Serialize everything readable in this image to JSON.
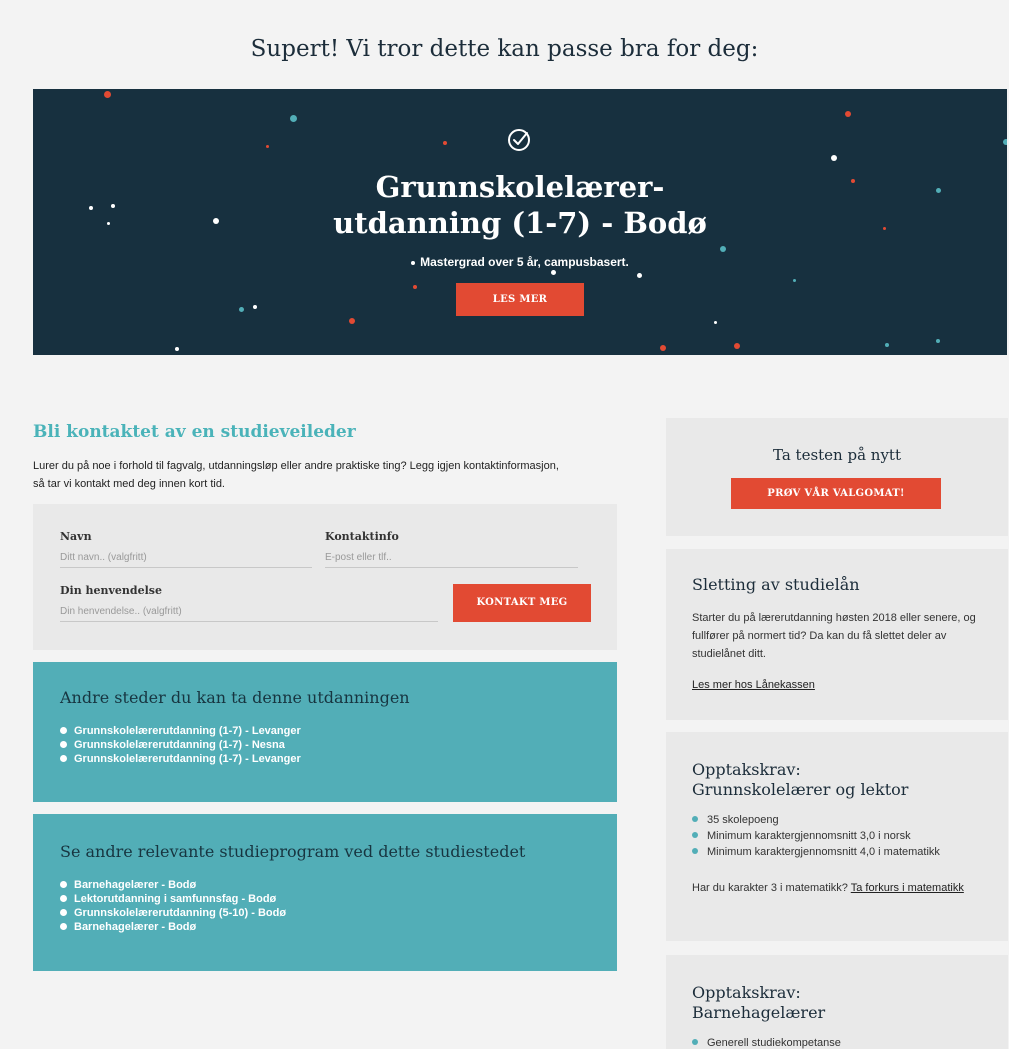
{
  "headline": "Supert! Vi tror dette kan passe bra for deg:",
  "hero": {
    "check_icon": "check-circle-icon",
    "title_line1": "Grunnskolelærer-",
    "title_line2": "utdanning (1-7) - Bodø",
    "subtitle": "Mastergrad over 5 år, campusbasert.",
    "button": "LES MER",
    "colors": {
      "background": "#17303f",
      "accent": "#e24a33",
      "teal": "#52aeb7"
    }
  },
  "contact": {
    "title": "Bli kontaktet av en studieveileder",
    "description": "Lurer du på noe i forhold til fagvalg, utdanningsløp eller andre praktiske ting? Legg igjen kontaktinformasjon, så tar vi kontakt med deg innen kort tid.",
    "name_label": "Navn",
    "name_placeholder": "Ditt navn.. (valgfritt)",
    "contact_label": "Kontaktinfo",
    "contact_placeholder": "E-post eller tlf..",
    "message_label": "Din henvendelse",
    "message_placeholder": "Din henvendelse.. (valgfritt)",
    "submit": "KONTAKT MEG"
  },
  "other_places": {
    "title": "Andre steder du kan ta denne utdanningen",
    "items": [
      "Grunnskolelærerutdanning (1-7) - Levanger",
      "Grunnskolelærerutdanning (1-7) - Nesna",
      "Grunnskolelærerutdanning (1-7) - Levanger"
    ]
  },
  "other_programs": {
    "title": "Se andre relevante studieprogram ved dette studiestedet",
    "items": [
      "Barnehagelærer - Bodø",
      "Lektorutdanning i samfunnsfag - Bodø",
      "Grunnskolelærerutdanning (5-10) - Bodø",
      "Barnehagelærer - Bodø"
    ]
  },
  "sidebar": {
    "retake": {
      "title": "Ta testen på nytt",
      "button": "PRØV VÅR VALGOMAT!"
    },
    "loan": {
      "title": "Sletting av studielån",
      "text": "Starter du på lærerutdanning høsten 2018 eller senere, og fullfører på normert tid? Da kan du få slettet deler av studielånet ditt.",
      "link": "Les mer hos Lånekassen"
    },
    "req1": {
      "title_line1": "Opptakskrav:",
      "title_line2": "Grunnskolelærer og lektor",
      "items": [
        "35 skolepoeng",
        "Minimum karaktergjennomsnitt 3,0 i norsk",
        "Minimum karaktergjennomsnitt 4,0 i matematikk"
      ],
      "note": "Har du karakter 3 i matematikk?",
      "note_link": "Ta forkurs i matematikk"
    },
    "req2": {
      "title_line1": "Opptakskrav:",
      "title_line2": "Barnehagelærer",
      "items": [
        "Generell studiekompetanse"
      ]
    }
  }
}
